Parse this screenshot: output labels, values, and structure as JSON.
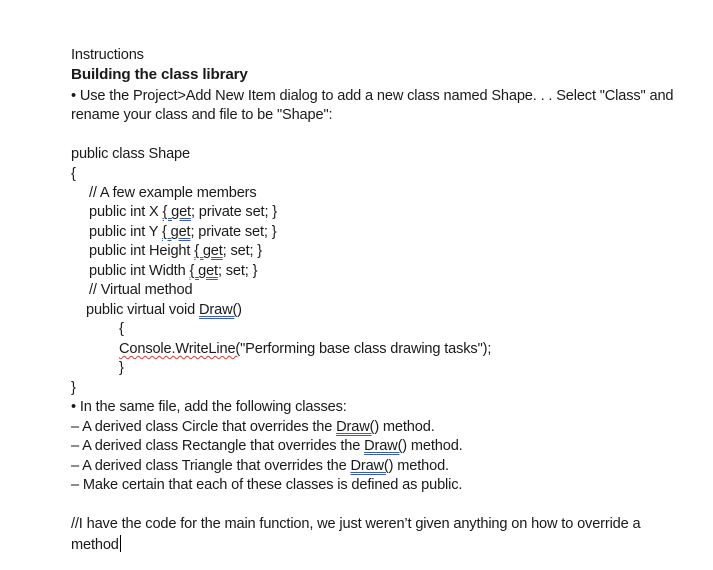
{
  "document": {
    "heading_small": "Instructions",
    "heading_bold": "Building the class library",
    "intro_line1": "• Use the Project>Add New Item dialog to add a new class named Shape. . . Select \"Class\" and",
    "intro_line2": "rename your class and file to be \"Shape\":",
    "code": {
      "class_decl": "public class Shape",
      "open_brace": "{",
      "comment_members": "// A few example members",
      "prop_x": {
        "pre": "public int X ",
        "flag": "{ get",
        "post": "; private set; }"
      },
      "prop_y": {
        "pre": "public int Y ",
        "flag": "{ get",
        "post": "; private set; }"
      },
      "prop_height": {
        "pre": "public int Height ",
        "flag": "{ get",
        "post": "; set; }"
      },
      "prop_width": {
        "pre": "public int Width ",
        "flag": "{ get",
        "post": "; set; }"
      },
      "comment_virtual": "// Virtual method",
      "method_decl": {
        "pre": "public virtual void ",
        "flag": "Draw(",
        "post": ")"
      },
      "method_open": "{",
      "method_body": {
        "flag": "Console.WriteLine(",
        "post": "\"Performing base class drawing tasks\");"
      },
      "method_close": "}",
      "class_close": "}"
    },
    "same_file_line": "• In the same file, add the following classes:",
    "derived": [
      {
        "pre": "– A derived class Circle that overrides the ",
        "flag": "Draw(",
        "post": ") method."
      },
      {
        "pre": "– A derived class Rectangle that overrides the ",
        "flag": "Draw(",
        "post": ") method."
      },
      {
        "pre": "– A derived class Triangle that overrides the ",
        "flag": "Draw(",
        "post": ") method."
      }
    ],
    "public_line": "– Make certain that each of these classes is defined as public.",
    "note_line1": "//I have the code for the main function, we just weren’t given anything on how to override a",
    "note_line2": "method"
  },
  "colors": {
    "grammar_underline": "#3b5dab",
    "spelling_underline": "#d83b3b"
  }
}
